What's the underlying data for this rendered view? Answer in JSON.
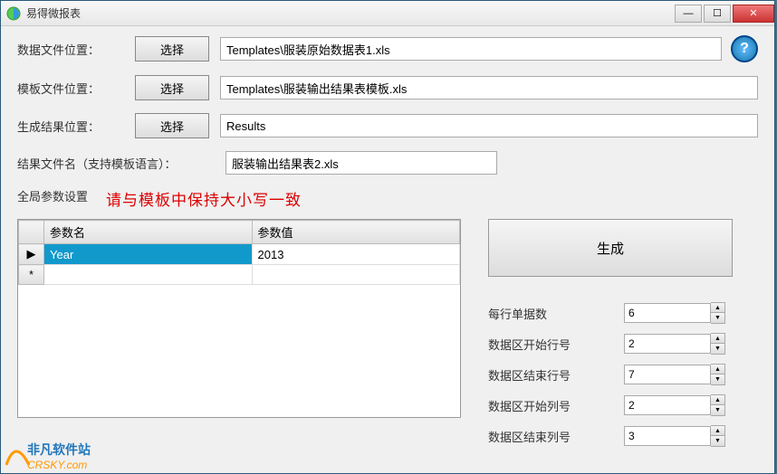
{
  "window": {
    "title": "易得微报表"
  },
  "titlebar_buttons": {
    "min": "—",
    "max": "☐",
    "close": "✕"
  },
  "help_symbol": "?",
  "rows": {
    "data_file": {
      "label": "数据文件位置：",
      "button": "选择",
      "value": "Templates\\服装原始数据表1.xls"
    },
    "template_file": {
      "label": "模板文件位置：",
      "button": "选择",
      "value": "Templates\\服装输出结果表模板.xls"
    },
    "result_location": {
      "label": "生成结果位置：",
      "button": "选择",
      "value": "Results"
    },
    "result_filename": {
      "label": "结果文件名（支持模板语言）：",
      "value": "服装输出结果表2.xls"
    }
  },
  "params": {
    "label": "全局参数设置",
    "warning": "请与模板中保持大小写一致",
    "columns": {
      "name": "参数名",
      "value": "参数值"
    },
    "row_markers": {
      "current": "▶",
      "new": "*"
    },
    "items": [
      {
        "name": "Year",
        "value": "2013"
      }
    ]
  },
  "generate_button": "生成",
  "numeric": [
    {
      "label": "每行单据数",
      "value": "6"
    },
    {
      "label": "数据区开始行号",
      "value": "2"
    },
    {
      "label": "数据区结束行号",
      "value": "7"
    },
    {
      "label": "数据区开始列号",
      "value": "2"
    },
    {
      "label": "数据区结束列号",
      "value": "3"
    }
  ],
  "spinner_arrows": {
    "up": "▲",
    "down": "▼"
  },
  "watermark": {
    "line1": "非凡软件站",
    "line2": "CRSKY.com"
  }
}
